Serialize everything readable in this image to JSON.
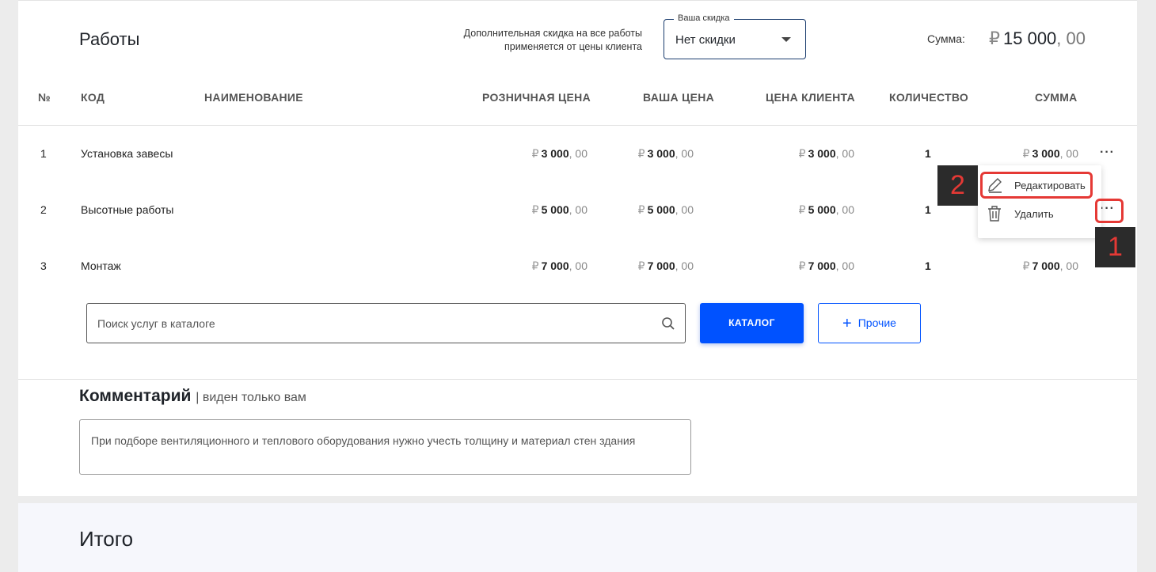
{
  "works": {
    "title": "Работы",
    "discount_note_line1": "Дополнительная скидка на все работы",
    "discount_note_line2": "применяется от цены клиента",
    "discount_select": {
      "legend": "Ваша скидка",
      "value": "Нет скидки"
    },
    "sum_label": "Сумма:",
    "sum_value": {
      "currency": "₽",
      "main": "15 000",
      "cents": ", 00"
    }
  },
  "table": {
    "headers": {
      "no": "№",
      "code": "КОД",
      "name": "НАИМЕНОВАНИЕ",
      "retail": "РОЗНИЧНАЯ ЦЕНА",
      "your": "ВАША ЦЕНА",
      "client": "ЦЕНА КЛИЕНТА",
      "qty": "КОЛИЧЕСТВО",
      "sum": "СУММА"
    },
    "currency": "₽",
    "rows": [
      {
        "no": "1",
        "name": "Установка завесы",
        "price": "3 000",
        "cents": ", 00",
        "qty": "1"
      },
      {
        "no": "2",
        "name": "Высотные работы",
        "price": "5 000",
        "cents": ", 00",
        "qty": "1"
      },
      {
        "no": "3",
        "name": "Монтаж",
        "price": "7 000",
        "cents": ", 00",
        "qty": "1"
      }
    ],
    "more": "···"
  },
  "context_menu": {
    "edit": "Редактировать",
    "delete": "Удалить"
  },
  "callouts": {
    "one": "1",
    "two": "2",
    "accent": "#e53935"
  },
  "search": {
    "placeholder": "Поиск услуг в каталоге"
  },
  "buttons": {
    "catalog": "КАТАЛОГ",
    "other_plus": "+",
    "other": "Прочие",
    "accent": "#0052ff"
  },
  "comment": {
    "title": "Комментарий",
    "subtitle": "| виден только вам",
    "text": "При подборе вентиляционного и теплового оборудования нужно учесть толщину и материал стен здания"
  },
  "total": {
    "title": "Итого"
  }
}
